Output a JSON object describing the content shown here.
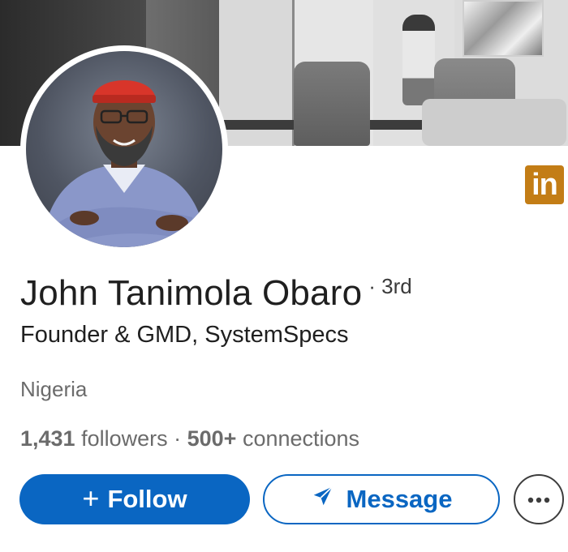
{
  "profile": {
    "name": "John Tanimola Obaro",
    "degree": "· 3rd",
    "headline": "Founder & GMD, SystemSpecs",
    "location": "Nigeria",
    "followers_count": "1,431",
    "followers_label": " followers · ",
    "connections_count": "500+",
    "connections_label": " connections"
  },
  "badge": {
    "text": "in",
    "color": "#c37d16"
  },
  "actions": {
    "follow_icon": "+",
    "follow_label": "Follow",
    "message_label": "Message",
    "more_icon": "more-dots-icon"
  },
  "colors": {
    "accent": "#0a66c2",
    "text": "#1f1f1f",
    "muted": "#6b6b6b"
  }
}
